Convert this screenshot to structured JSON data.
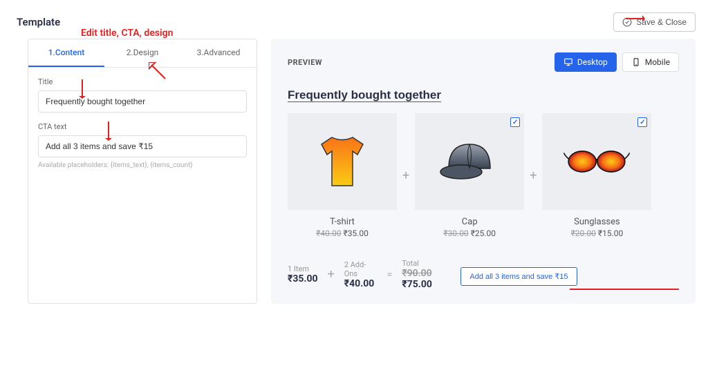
{
  "header": {
    "title": "Template",
    "save_close": "Save & Close"
  },
  "annotations": {
    "edit_title": "Edit title, CTA, design"
  },
  "tabs": {
    "content": "1.Content",
    "design": "2.Design",
    "advanced": "3.Advanced"
  },
  "fields": {
    "title_label": "Title",
    "title_value": "Frequently bought together",
    "cta_label": "CTA text",
    "cta_value": "Add all 3 items and save ₹15",
    "placeholders_hint": "Available placeholders: {items_text}, {items_count}"
  },
  "preview": {
    "label": "PREVIEW",
    "desktop": "Desktop",
    "mobile": "Mobile",
    "fbt_title": "Frequently bought together",
    "products": [
      {
        "name": "T-shirt",
        "old_price": "₹40.00",
        "new_price": "₹35.00",
        "icon": "tshirt"
      },
      {
        "name": "Cap",
        "old_price": "₹30.00",
        "new_price": "₹25.00",
        "icon": "cap"
      },
      {
        "name": "Sunglasses",
        "old_price": "₹20.00",
        "new_price": "₹15.00",
        "icon": "sunglasses"
      }
    ],
    "summary": {
      "item_label": "1 Item",
      "item_value": "₹35.00",
      "addon_label": "2 Add-Ons",
      "addon_value": "₹40.00",
      "total_label": "Total",
      "total_old": "₹90.00",
      "total_new": "₹75.00"
    },
    "cta_button": "Add all 3 items and save ₹15"
  }
}
